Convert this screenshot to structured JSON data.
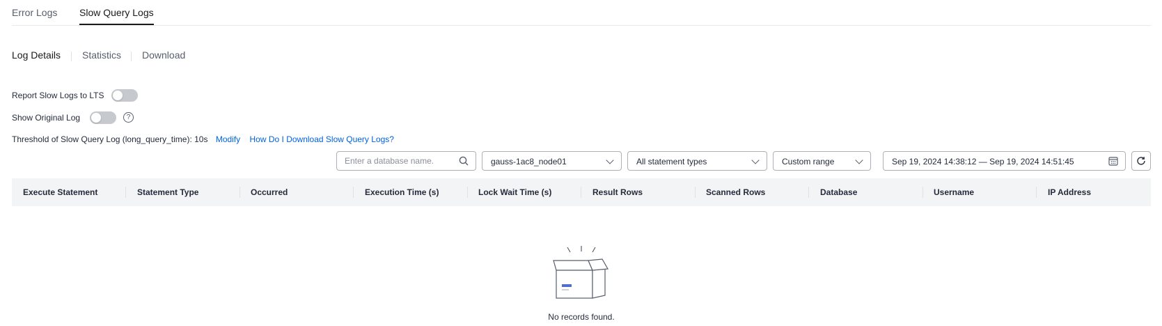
{
  "tabs": {
    "error_logs": "Error Logs",
    "slow_query_logs": "Slow Query Logs"
  },
  "subtabs": {
    "log_details": "Log Details",
    "statistics": "Statistics",
    "download": "Download"
  },
  "settings": {
    "report_lts_label": "Report Slow Logs to LTS",
    "report_lts_enabled": false,
    "show_original_label": "Show Original Log",
    "show_original_enabled": false,
    "help_glyph": "?",
    "threshold_label": "Threshold of Slow Query Log (long_query_time): 10s",
    "modify_link": "Modify",
    "download_help_link": "How Do I Download Slow Query Logs?"
  },
  "filters": {
    "database_placeholder": "Enter a database name.",
    "node_value": "gauss-1ac8_node01",
    "statement_type_value": "All statement types",
    "range_value": "Custom range",
    "date_range": "Sep 19, 2024 14:38:12 — Sep 19, 2024 14:51:45"
  },
  "table": {
    "columns": [
      "Execute Statement",
      "Statement Type",
      "Occurred",
      "Execution Time (s)",
      "Lock Wait Time (s)",
      "Result Rows",
      "Scanned Rows",
      "Database",
      "Username",
      "IP Address"
    ],
    "empty_text": "No records found."
  },
  "colors": {
    "link": "#0062e4",
    "toggle_off": "#c6cacf",
    "header_bg": "#f3f4f6",
    "accent": "#526ecc"
  }
}
